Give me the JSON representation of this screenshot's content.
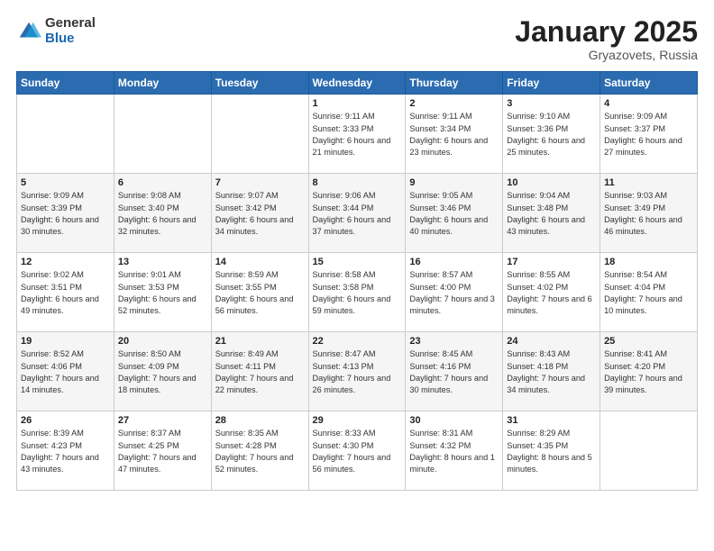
{
  "header": {
    "logo_general": "General",
    "logo_blue": "Blue",
    "month_title": "January 2025",
    "location": "Gryazovets, Russia"
  },
  "days_of_week": [
    "Sunday",
    "Monday",
    "Tuesday",
    "Wednesday",
    "Thursday",
    "Friday",
    "Saturday"
  ],
  "weeks": [
    [
      {
        "day": "",
        "text": ""
      },
      {
        "day": "",
        "text": ""
      },
      {
        "day": "",
        "text": ""
      },
      {
        "day": "1",
        "text": "Sunrise: 9:11 AM\nSunset: 3:33 PM\nDaylight: 6 hours\nand 21 minutes."
      },
      {
        "day": "2",
        "text": "Sunrise: 9:11 AM\nSunset: 3:34 PM\nDaylight: 6 hours\nand 23 minutes."
      },
      {
        "day": "3",
        "text": "Sunrise: 9:10 AM\nSunset: 3:36 PM\nDaylight: 6 hours\nand 25 minutes."
      },
      {
        "day": "4",
        "text": "Sunrise: 9:09 AM\nSunset: 3:37 PM\nDaylight: 6 hours\nand 27 minutes."
      }
    ],
    [
      {
        "day": "5",
        "text": "Sunrise: 9:09 AM\nSunset: 3:39 PM\nDaylight: 6 hours\nand 30 minutes."
      },
      {
        "day": "6",
        "text": "Sunrise: 9:08 AM\nSunset: 3:40 PM\nDaylight: 6 hours\nand 32 minutes."
      },
      {
        "day": "7",
        "text": "Sunrise: 9:07 AM\nSunset: 3:42 PM\nDaylight: 6 hours\nand 34 minutes."
      },
      {
        "day": "8",
        "text": "Sunrise: 9:06 AM\nSunset: 3:44 PM\nDaylight: 6 hours\nand 37 minutes."
      },
      {
        "day": "9",
        "text": "Sunrise: 9:05 AM\nSunset: 3:46 PM\nDaylight: 6 hours\nand 40 minutes."
      },
      {
        "day": "10",
        "text": "Sunrise: 9:04 AM\nSunset: 3:48 PM\nDaylight: 6 hours\nand 43 minutes."
      },
      {
        "day": "11",
        "text": "Sunrise: 9:03 AM\nSunset: 3:49 PM\nDaylight: 6 hours\nand 46 minutes."
      }
    ],
    [
      {
        "day": "12",
        "text": "Sunrise: 9:02 AM\nSunset: 3:51 PM\nDaylight: 6 hours\nand 49 minutes."
      },
      {
        "day": "13",
        "text": "Sunrise: 9:01 AM\nSunset: 3:53 PM\nDaylight: 6 hours\nand 52 minutes."
      },
      {
        "day": "14",
        "text": "Sunrise: 8:59 AM\nSunset: 3:55 PM\nDaylight: 6 hours\nand 56 minutes."
      },
      {
        "day": "15",
        "text": "Sunrise: 8:58 AM\nSunset: 3:58 PM\nDaylight: 6 hours\nand 59 minutes."
      },
      {
        "day": "16",
        "text": "Sunrise: 8:57 AM\nSunset: 4:00 PM\nDaylight: 7 hours\nand 3 minutes."
      },
      {
        "day": "17",
        "text": "Sunrise: 8:55 AM\nSunset: 4:02 PM\nDaylight: 7 hours\nand 6 minutes."
      },
      {
        "day": "18",
        "text": "Sunrise: 8:54 AM\nSunset: 4:04 PM\nDaylight: 7 hours\nand 10 minutes."
      }
    ],
    [
      {
        "day": "19",
        "text": "Sunrise: 8:52 AM\nSunset: 4:06 PM\nDaylight: 7 hours\nand 14 minutes."
      },
      {
        "day": "20",
        "text": "Sunrise: 8:50 AM\nSunset: 4:09 PM\nDaylight: 7 hours\nand 18 minutes."
      },
      {
        "day": "21",
        "text": "Sunrise: 8:49 AM\nSunset: 4:11 PM\nDaylight: 7 hours\nand 22 minutes."
      },
      {
        "day": "22",
        "text": "Sunrise: 8:47 AM\nSunset: 4:13 PM\nDaylight: 7 hours\nand 26 minutes."
      },
      {
        "day": "23",
        "text": "Sunrise: 8:45 AM\nSunset: 4:16 PM\nDaylight: 7 hours\nand 30 minutes."
      },
      {
        "day": "24",
        "text": "Sunrise: 8:43 AM\nSunset: 4:18 PM\nDaylight: 7 hours\nand 34 minutes."
      },
      {
        "day": "25",
        "text": "Sunrise: 8:41 AM\nSunset: 4:20 PM\nDaylight: 7 hours\nand 39 minutes."
      }
    ],
    [
      {
        "day": "26",
        "text": "Sunrise: 8:39 AM\nSunset: 4:23 PM\nDaylight: 7 hours\nand 43 minutes."
      },
      {
        "day": "27",
        "text": "Sunrise: 8:37 AM\nSunset: 4:25 PM\nDaylight: 7 hours\nand 47 minutes."
      },
      {
        "day": "28",
        "text": "Sunrise: 8:35 AM\nSunset: 4:28 PM\nDaylight: 7 hours\nand 52 minutes."
      },
      {
        "day": "29",
        "text": "Sunrise: 8:33 AM\nSunset: 4:30 PM\nDaylight: 7 hours\nand 56 minutes."
      },
      {
        "day": "30",
        "text": "Sunrise: 8:31 AM\nSunset: 4:32 PM\nDaylight: 8 hours\nand 1 minute."
      },
      {
        "day": "31",
        "text": "Sunrise: 8:29 AM\nSunset: 4:35 PM\nDaylight: 8 hours\nand 5 minutes."
      },
      {
        "day": "",
        "text": ""
      }
    ]
  ]
}
